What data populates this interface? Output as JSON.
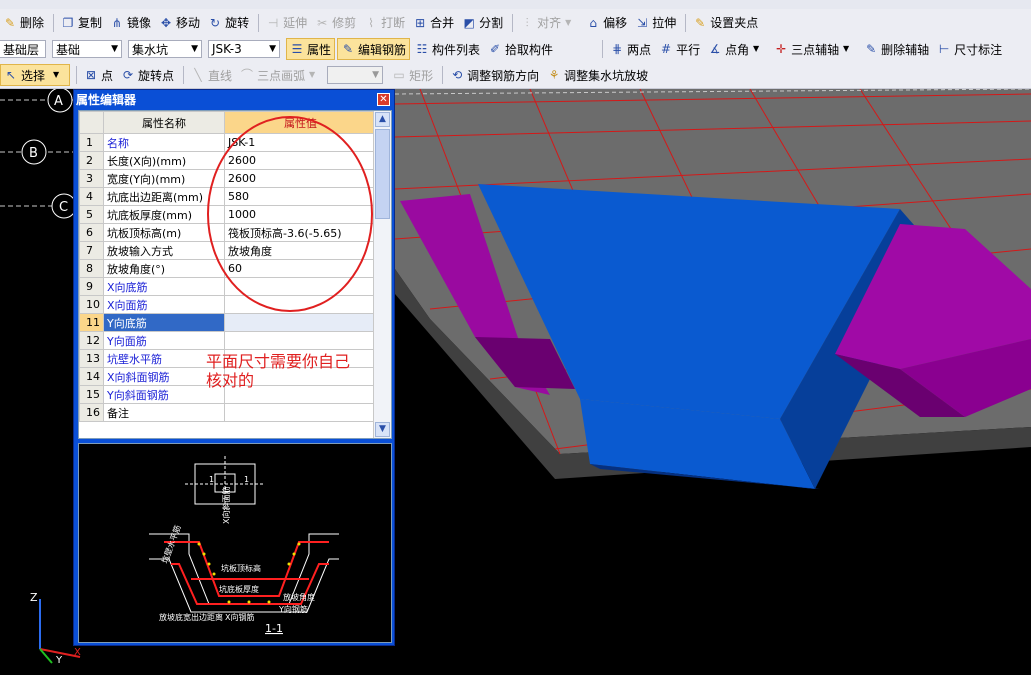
{
  "toolbar_top_partial": [
    "...",
    "..."
  ],
  "toolbar1": {
    "delete": "删除",
    "copy": "复制",
    "mirror": "镜像",
    "move": "移动",
    "rotate": "旋转",
    "extend": "延伸",
    "trim": "修剪",
    "break": "打断",
    "merge": "合并",
    "split": "分割",
    "align": "对齐",
    "offset": "偏移",
    "stretch": "拉伸",
    "set_grip": "设置夹点"
  },
  "toolbar2": {
    "floor": "基础层",
    "category": "基础",
    "component_type": "集水坑",
    "component": "JSK-3",
    "properties": "属性",
    "edit_rebar": "编辑钢筋",
    "component_list": "构件列表",
    "pick_component": "拾取构件",
    "two_points": "两点",
    "parallel": "平行",
    "point_angle": "点角",
    "three_point_axis": "三点辅轴",
    "delete_axis": "删除辅轴",
    "dimension": "尺寸标注"
  },
  "toolbar3": {
    "select": "选择",
    "point": "点",
    "rotate_point": "旋转点",
    "line": "直线",
    "three_point_arc": "三点画弧",
    "combo_value": "",
    "rectangle": "矩形",
    "adjust_rebar_dir": "调整钢筋方向",
    "adjust_slope": "调整集水坑放坡"
  },
  "axes": {
    "a": "A",
    "b": "B",
    "c": "C"
  },
  "property_editor": {
    "title": "属性编辑器",
    "close": "✕",
    "col_name": "属性名称",
    "col_value": "属性值",
    "selected_row": 11,
    "rows": [
      {
        "no": "1",
        "name": "名称",
        "value": "JSK-1",
        "blue": true
      },
      {
        "no": "2",
        "name": "长度(X向)(mm)",
        "value": "2600",
        "blue": false
      },
      {
        "no": "3",
        "name": "宽度(Y向)(mm)",
        "value": "2600",
        "blue": false
      },
      {
        "no": "4",
        "name": "坑底出边距离(mm)",
        "value": "580",
        "blue": false
      },
      {
        "no": "5",
        "name": "坑底板厚度(mm)",
        "value": "1000",
        "blue": false
      },
      {
        "no": "6",
        "name": "坑板顶标高(m)",
        "value": "筏板顶标高-3.6(-5.65)",
        "blue": false
      },
      {
        "no": "7",
        "name": "放坡输入方式",
        "value": "放坡角度",
        "blue": false
      },
      {
        "no": "8",
        "name": "放坡角度(°)",
        "value": "60",
        "blue": false
      },
      {
        "no": "9",
        "name": "X向底筋",
        "value": "",
        "blue": true
      },
      {
        "no": "10",
        "name": "X向面筋",
        "value": "",
        "blue": true
      },
      {
        "no": "11",
        "name": "Y向底筋",
        "value": "",
        "blue": true
      },
      {
        "no": "12",
        "name": "Y向面筋",
        "value": "",
        "blue": true
      },
      {
        "no": "13",
        "name": "坑壁水平筋",
        "value": "",
        "blue": true
      },
      {
        "no": "14",
        "name": "X向斜面钢筋",
        "value": "",
        "blue": true
      },
      {
        "no": "15",
        "name": "Y向斜面钢筋",
        "value": "",
        "blue": true
      },
      {
        "no": "16",
        "name": "备注",
        "value": "",
        "blue": false
      }
    ],
    "annotation_line1": "平面尺寸需要你自己",
    "annotation_line2": "核对的",
    "preview": {
      "label_1": "1",
      "label_1b": "1",
      "label_x_rebar": "X向斜面筋",
      "label_pit_top": "坑板顶标高",
      "label_slab_thk": "坑底板厚度",
      "label_slope_angle": "放坡角度",
      "label_y_rebar": "Y向钢筋",
      "label_edge": "放坡底宽出边距离",
      "label_x_bottom": "X向钢筋",
      "label_wall": "坑壁水平筋",
      "section_label": "1-1"
    }
  },
  "coord_axes": {
    "z": "Z",
    "y": "Y",
    "x": "X"
  },
  "colors": {
    "slab_top": "#6c6c6c",
    "slab_side": "#3a3a3a",
    "pit": "#0a5ad0",
    "pit_dark": "#063f9a",
    "ramp": "#9a0aa0",
    "ramp_dark": "#5c0060",
    "grid_red": "#d41818",
    "annotation": "#e02020"
  }
}
